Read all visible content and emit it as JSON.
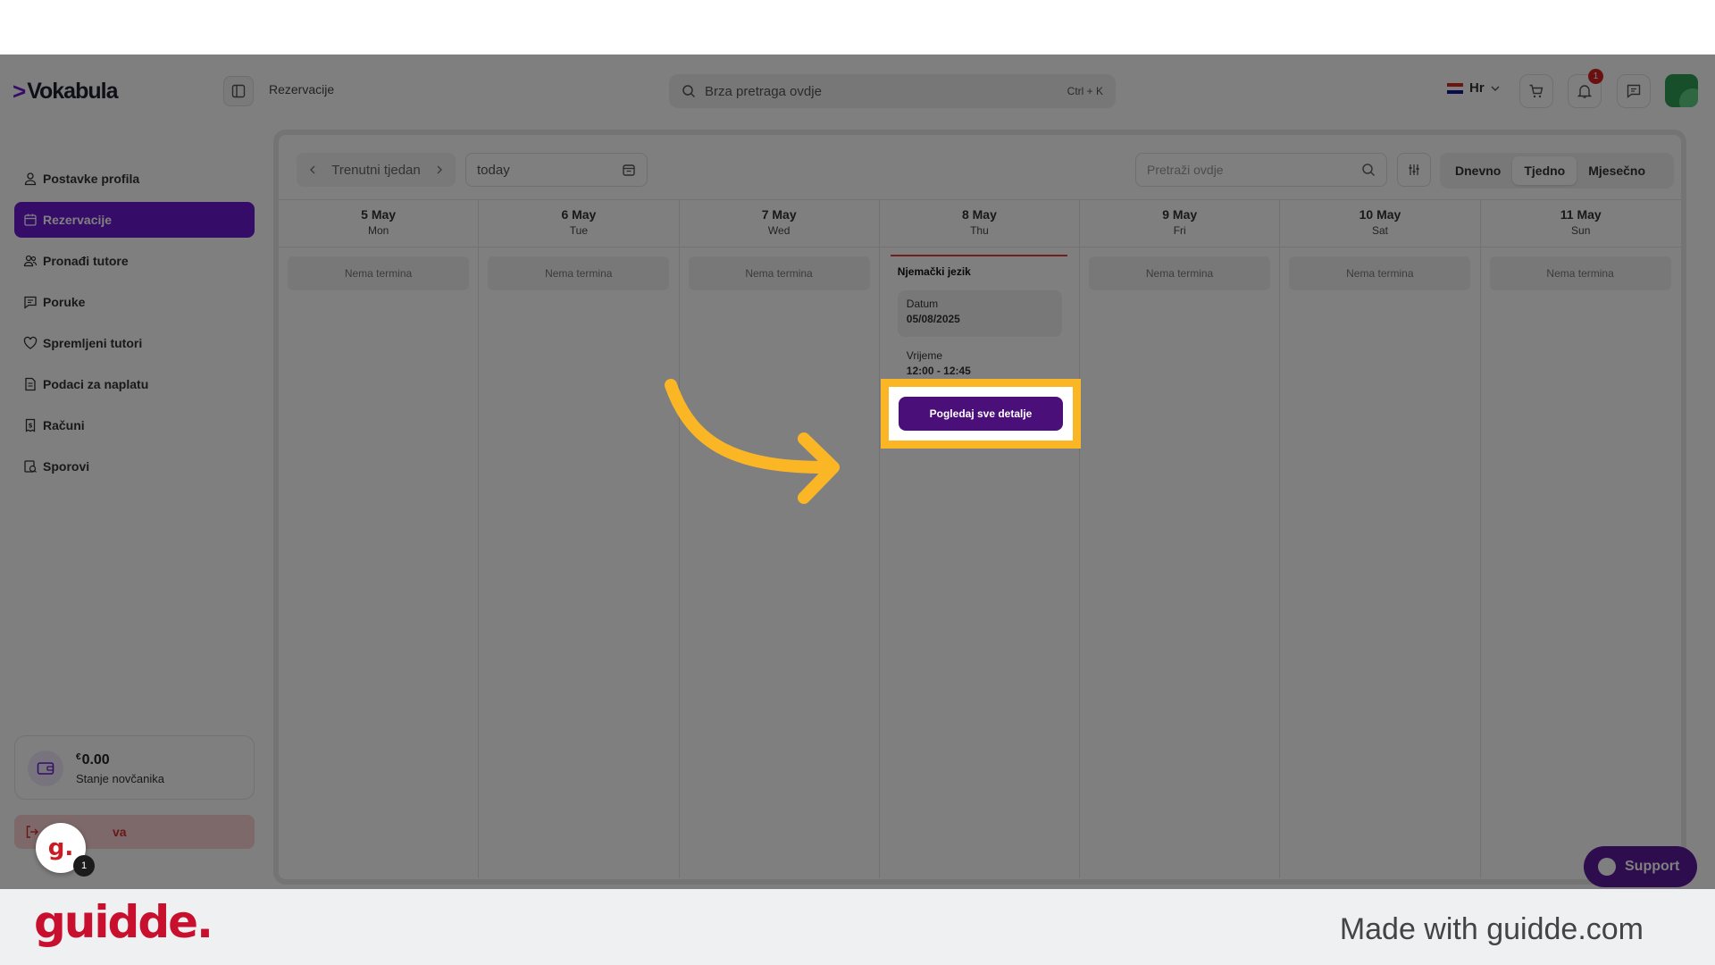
{
  "app": {
    "logo": "Vokabula",
    "breadcrumb": "Rezervacije",
    "search_placeholder": "Brza pretraga ovdje",
    "search_shortcut": "Ctrl + K",
    "language": "Hr",
    "notification_count": "1",
    "accent_color": "#6a1bd0"
  },
  "sidebar": {
    "items": [
      {
        "label": "Postavke profila",
        "icon": "user-icon"
      },
      {
        "label": "Rezervacije",
        "icon": "calendar-icon",
        "active": true
      },
      {
        "label": "Pronađi tutore",
        "icon": "users-icon"
      },
      {
        "label": "Poruke",
        "icon": "message-icon"
      },
      {
        "label": "Spremljeni tutori",
        "icon": "heart-icon"
      },
      {
        "label": "Podaci za naplatu",
        "icon": "billing-icon"
      },
      {
        "label": "Računi",
        "icon": "receipt-icon"
      },
      {
        "label": "Sporovi",
        "icon": "dispute-icon"
      }
    ],
    "wallet": {
      "currency": "€",
      "amount": "0.00",
      "label": "Stanje novčanika"
    },
    "logout_label": "va"
  },
  "calendar": {
    "week_label": "Trenutni tjedan",
    "date_value": "today",
    "search_placeholder": "Pretraži ovdje",
    "views": [
      "Dnevno",
      "Tjedno",
      "Mjesečno"
    ],
    "active_view": "Tjedno",
    "days": [
      {
        "date": "5 May",
        "dow": "Mon",
        "empty": "Nema termina"
      },
      {
        "date": "6 May",
        "dow": "Tue",
        "empty": "Nema termina"
      },
      {
        "date": "7 May",
        "dow": "Wed",
        "empty": "Nema termina"
      },
      {
        "date": "8 May",
        "dow": "Thu"
      },
      {
        "date": "9 May",
        "dow": "Fri",
        "empty": "Nema termina"
      },
      {
        "date": "10 May",
        "dow": "Sat",
        "empty": "Nema termina"
      },
      {
        "date": "11 May",
        "dow": "Sun",
        "empty": "Nema termina"
      }
    ],
    "event": {
      "title": "Njemački jezik",
      "date_label": "Datum",
      "date_value": "05/08/2025",
      "time_label": "Vrijeme",
      "time_value": "12:00 - 12:45",
      "button_label": "Pogledaj sve detalje"
    }
  },
  "support_label": "Support",
  "guidde": {
    "bubble": "g.",
    "count": "1",
    "brand": "guidde.",
    "made_with": "Made with guidde.com"
  }
}
